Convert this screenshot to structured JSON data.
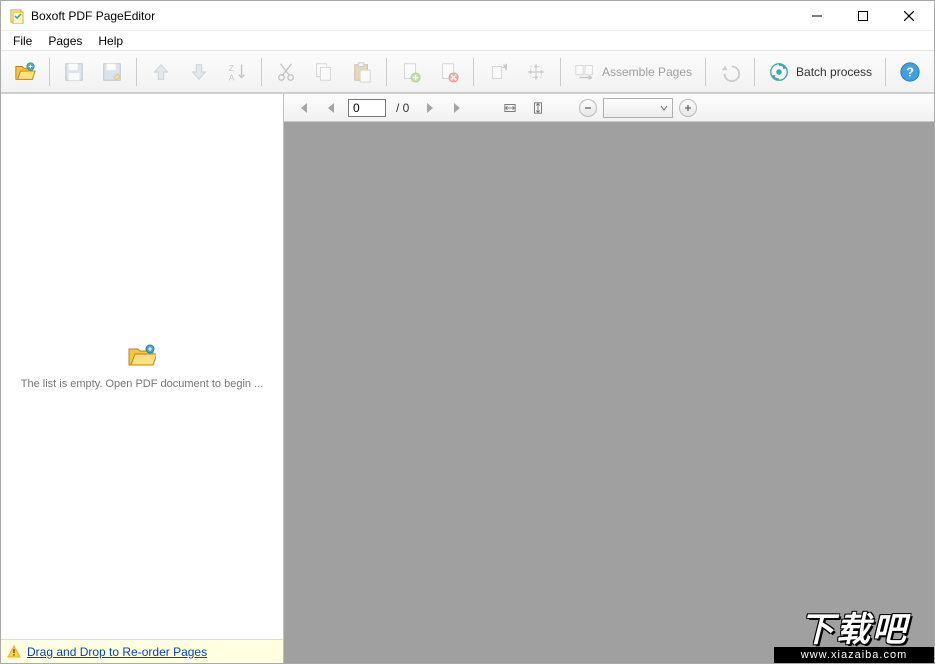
{
  "window": {
    "title": "Boxoft PDF PageEditor"
  },
  "menu": {
    "file": "File",
    "pages": "Pages",
    "help": "Help"
  },
  "toolbar": {
    "assemble_label": "Assemble Pages",
    "batch_label": "Batch process"
  },
  "sidebar": {
    "empty_text": "The list is empty. Open  PDF document to begin ...",
    "footer_link": "Drag and Drop to Re-order Pages"
  },
  "pager": {
    "current": "0",
    "total_label": "/ 0"
  },
  "watermark": {
    "text": "下载吧",
    "url": "www.xiazaiba.com"
  }
}
